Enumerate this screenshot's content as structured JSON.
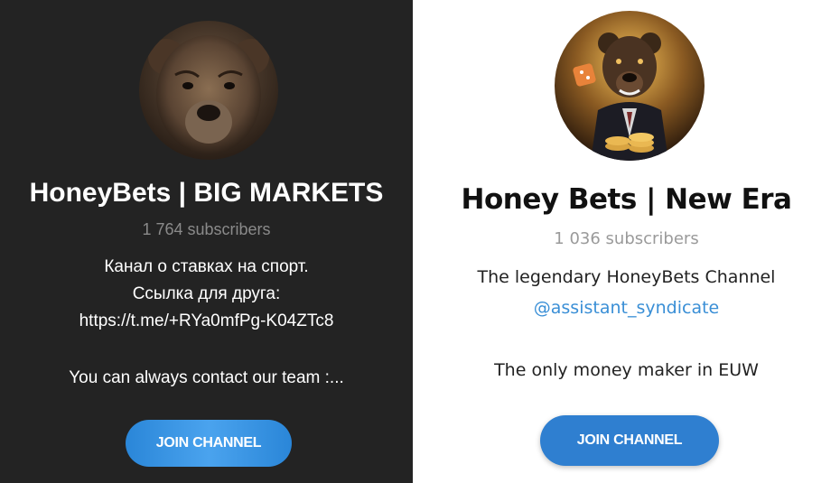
{
  "left_channel": {
    "title": "HoneyBets | BIG MARKETS",
    "subscribers": "1 764 subscribers",
    "description_lines": [
      "Канал о ставках на спорт.",
      "Ссылка для друга:",
      "https://t.me/+RYa0mfPg-K04ZTc8",
      "",
      "You can always contact our team :..."
    ],
    "join_label": "JOIN CHANNEL",
    "avatar_icon": "bear-head-avatar"
  },
  "right_channel": {
    "title": "Honey Bets | New Era",
    "subscribers": "1 036 subscribers",
    "description_line_1": "The legendary HoneyBets Channel",
    "description_link": "@assistant_syndicate",
    "description_line_3": "The only money maker in EUW",
    "join_label": "JOIN CHANNEL",
    "avatar_icon": "bear-in-suit-with-dice-avatar"
  },
  "colors": {
    "left_bg": "#232323",
    "right_bg": "#ffffff",
    "button_blue": "#2f7fd0",
    "link_blue": "#3a8fd6"
  }
}
